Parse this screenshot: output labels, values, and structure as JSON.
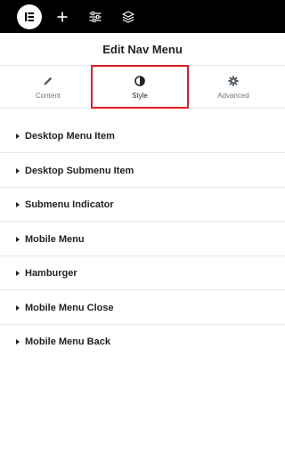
{
  "topbar": {
    "logo_icon": "elementor-logo-icon",
    "tools": [
      "plus-icon",
      "sliders-icon",
      "layers-icon"
    ]
  },
  "panel": {
    "title": "Edit Nav Menu"
  },
  "tabs": [
    {
      "label": "Content",
      "icon": "pencil-icon",
      "active": false
    },
    {
      "label": "Style",
      "icon": "contrast-icon",
      "active": true
    },
    {
      "label": "Advanced",
      "icon": "gear-icon",
      "active": false
    }
  ],
  "highlight_color": "#e31e24",
  "sections": [
    {
      "label": "Desktop Menu Item"
    },
    {
      "label": "Desktop Submenu Item"
    },
    {
      "label": "Submenu Indicator"
    },
    {
      "label": "Mobile Menu"
    },
    {
      "label": "Hamburger"
    },
    {
      "label": "Mobile Menu Close"
    },
    {
      "label": "Mobile Menu Back"
    }
  ]
}
